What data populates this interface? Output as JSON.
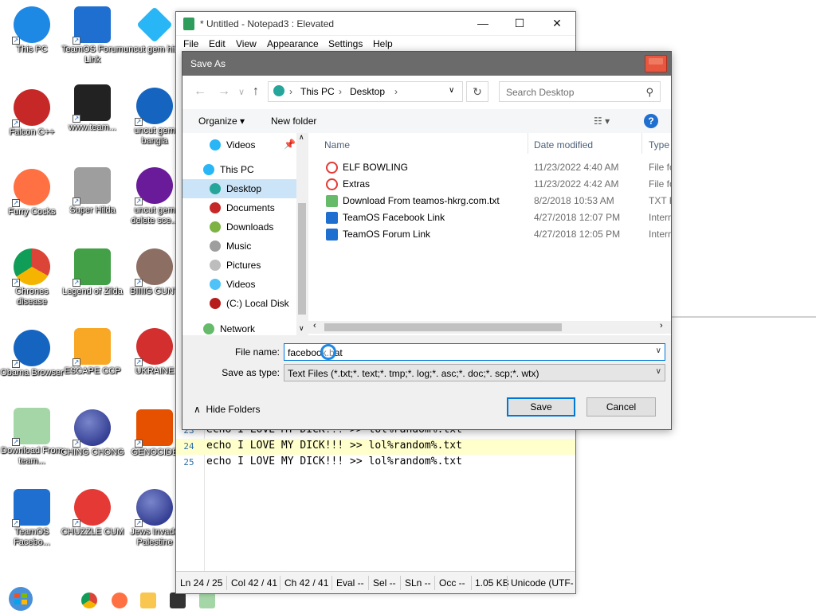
{
  "desktop": {
    "icons": [
      {
        "label": "This PC",
        "color": "#1e88e5"
      },
      {
        "label": "TeamOS Forum Link",
        "color": "#1e6fd0"
      },
      {
        "label": "uncut gem hindi",
        "color": "#29b6f6"
      },
      {
        "label": "Falcon C++",
        "color": "#c62828"
      },
      {
        "label": "www.team...",
        "color": "#222222"
      },
      {
        "label": "uncut gem bangla",
        "color": "#1565c0"
      },
      {
        "label": "Furry Cocks",
        "color": "#ff7043"
      },
      {
        "label": "Super Hilda",
        "color": "#9e9e9e"
      },
      {
        "label": "uncut gem delete sce...",
        "color": "#6a1b9a"
      },
      {
        "label": "Chrones disease",
        "color": "#4caf50"
      },
      {
        "label": "Legend of Zilda",
        "color": "#43a047"
      },
      {
        "label": "BIIIIG CUNT",
        "color": "#8d6e63"
      },
      {
        "label": "Obama Browser",
        "color": "#1565c0"
      },
      {
        "label": "ESCAPE CCP",
        "color": "#f9a825"
      },
      {
        "label": "UKRAINE",
        "color": "#d32f2f"
      },
      {
        "label": "Download From team...",
        "color": "#66bb6a"
      },
      {
        "label": "CHING CHONG",
        "color": "#3949ab"
      },
      {
        "label": "GENOCIDE",
        "color": "#e65100"
      },
      {
        "label": "TeamOS Facebo...",
        "color": "#1e6fd0"
      },
      {
        "label": "CHUZZLE CUM",
        "color": "#e53935"
      },
      {
        "label": "Jews Invade Palestine",
        "color": "#283593"
      }
    ]
  },
  "notepad": {
    "title": "* Untitled - Notepad3 : Elevated",
    "menu": [
      "File",
      "Edit",
      "View",
      "Appearance",
      "Settings",
      "Help"
    ],
    "lines": [
      {
        "num": "23",
        "text": "echo I LOVE MY DICK!!! >> lol%random%.txt"
      },
      {
        "num": "24",
        "text": "echo I LOVE MY DICK!!! >> lol%random%.txt"
      },
      {
        "num": "25",
        "text": "echo I LOVE MY DICK!!! >> lol%random%.txt"
      }
    ],
    "status": {
      "ln": "Ln  24 / 25",
      "col": "Col  42 / 41",
      "ch": "Ch  42 / 41",
      "eval": "Eval  --",
      "sel": "Sel  --",
      "sln": "SLn  --",
      "occ": "Occ  --",
      "size": "1.05 KB",
      "encoding": "Unicode (UTF-"
    }
  },
  "dialog": {
    "title": "Save As",
    "breadcrumb": [
      "This PC",
      "Desktop"
    ],
    "search_placeholder": "Search Desktop",
    "organize": "Organize",
    "new_folder": "New folder",
    "tree": [
      {
        "label": "Videos",
        "color": "#29b6f6"
      },
      {
        "label": "This PC",
        "color": "#29b6f6"
      },
      {
        "label": "Desktop",
        "color": "#26a69a"
      },
      {
        "label": "Documents",
        "color": "#c62828"
      },
      {
        "label": "Downloads",
        "color": "#7cb342"
      },
      {
        "label": "Music",
        "color": "#9e9e9e"
      },
      {
        "label": "Pictures",
        "color": "#bdbdbd"
      },
      {
        "label": "Videos",
        "color": "#4fc3f7"
      },
      {
        "label": "(C:) Local Disk",
        "color": "#b71c1c"
      },
      {
        "label": "Network",
        "color": "#66bb6a"
      }
    ],
    "columns": [
      "Name",
      "Date modified",
      "Type"
    ],
    "files": [
      {
        "name": "ELF BOWLING",
        "date": "11/23/2022 4:40 AM",
        "type": "File fo",
        "icon": "#e53935"
      },
      {
        "name": "Extras",
        "date": "11/23/2022 4:42 AM",
        "type": "File fo",
        "icon": "#e53935"
      },
      {
        "name": "Download From teamos-hkrg.com.txt",
        "date": "8/2/2018 10:53 AM",
        "type": "TXT F",
        "icon": "#43a047"
      },
      {
        "name": "TeamOS Facebook Link",
        "date": "4/27/2018 12:07 PM",
        "type": "Intern",
        "icon": "#1e6fd0"
      },
      {
        "name": "TeamOS Forum Link",
        "date": "4/27/2018 12:05 PM",
        "type": "Intern",
        "icon": "#1e6fd0"
      }
    ],
    "file_name_label": "File name:",
    "file_name_value": "facebook.bat",
    "save_type_label": "Save as type:",
    "save_type_value": "Text Files (*.txt;*. text;*. tmp;*. log;*. asc;*. doc;*. scp;*. wtx)",
    "hide_folders": "Hide Folders",
    "save": "Save",
    "cancel": "Cancel"
  },
  "colors": {
    "accent": "#0078d7",
    "selection": "#cce4f7",
    "title_bar": "#6b6b6b"
  }
}
